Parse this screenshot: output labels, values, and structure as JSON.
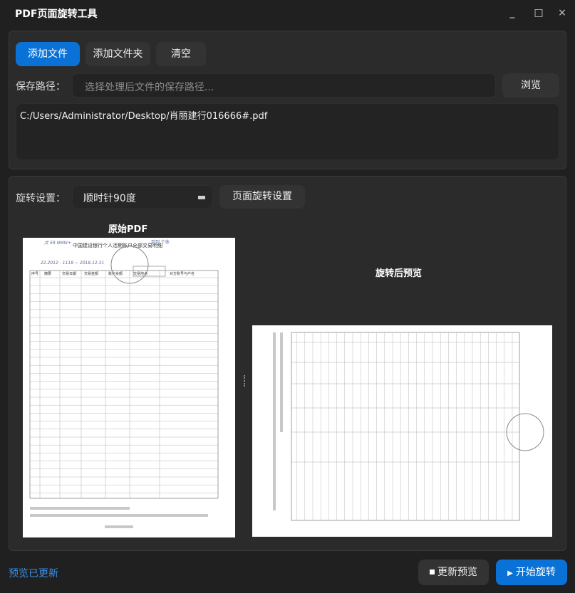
{
  "window": {
    "title": "PDF页面旋转工具",
    "controls": [
      "_",
      "□",
      "×"
    ]
  },
  "file_panel": {
    "add_file_label": "添加文件",
    "add_folder_label": "添加文件夹",
    "clear_label": "清空",
    "save_path_label": "保存路径：",
    "save_path_placeholder": "选择处理后文件的保存路径...",
    "browse_label": "浏览",
    "files": [
      "C:/Users/Administrator/Desktop/肖丽建行016666#.pdf"
    ]
  },
  "rotate_panel": {
    "settings_label": "旋转设置：",
    "rotation_value": "顺时针90度",
    "page_settings_button": "页面旋转设置",
    "original_title": "原始PDF",
    "rotated_title": "旋转后预览",
    "doc_header": "中国建设银行个人活期账户全部交易明细",
    "doc_columns": [
      "序号",
      "摘要",
      "交易日期",
      "交易金额",
      "账户余额",
      "交易地点",
      "对方账号与户名"
    ]
  },
  "footer": {
    "status_text": "预览已更新",
    "refresh_label": "更新预览",
    "start_label": "开始旋转"
  },
  "colors": {
    "accent": "#0a72d6",
    "status": "#3a8ee6"
  }
}
